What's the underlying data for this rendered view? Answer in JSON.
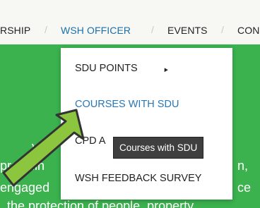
{
  "nav": {
    "items": [
      {
        "label": "RSHIP"
      },
      {
        "label": "WSH OFFICER"
      },
      {
        "label": "EVENTS"
      },
      {
        "label": "CON"
      }
    ],
    "active_color": "#1c6fa8",
    "separator": "/"
  },
  "dropdown": {
    "items": [
      {
        "label": "SDU POINTS",
        "has_submenu": true
      },
      {
        "label": "COURSES WITH SDU",
        "hovered": true
      },
      {
        "label": "CPD A"
      },
      {
        "label": "WSH FEEDBACK SURVEY"
      }
    ]
  },
  "tooltip": {
    "text": "Courses with SDU"
  },
  "hero": {
    "lines": [
      "y C",
      "providin",
      "engaged",
      "the protection of people, property"
    ],
    "right_fragments": [
      "n,",
      "ce"
    ],
    "background": "#3bb24e"
  },
  "pointer_arrow": {
    "fill": "#8cc63f",
    "stroke": "#333333"
  }
}
